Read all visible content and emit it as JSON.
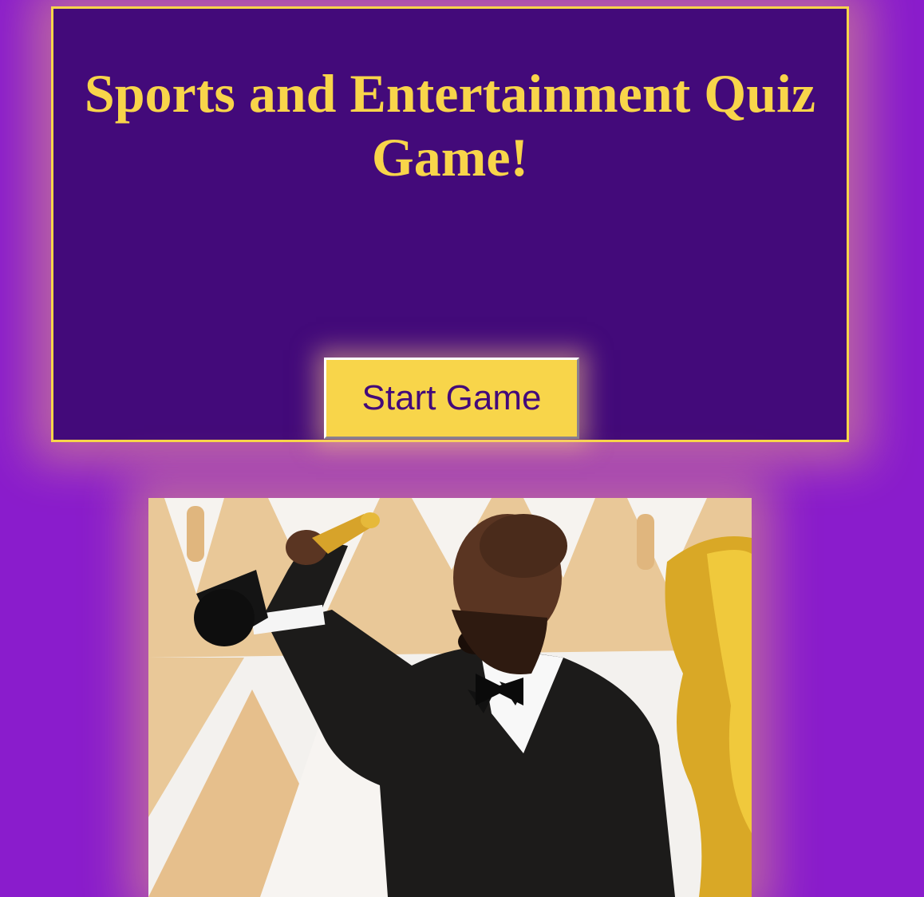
{
  "quiz": {
    "title": "Sports and Entertainment Quiz Game!",
    "start_button_label": "Start Game"
  },
  "image": {
    "subject": "man in tuxedo raising gold award statuette"
  },
  "colors": {
    "page_background": "#8a1ccc",
    "panel_background": "#430a7a",
    "accent_gold": "#f8d54a"
  }
}
